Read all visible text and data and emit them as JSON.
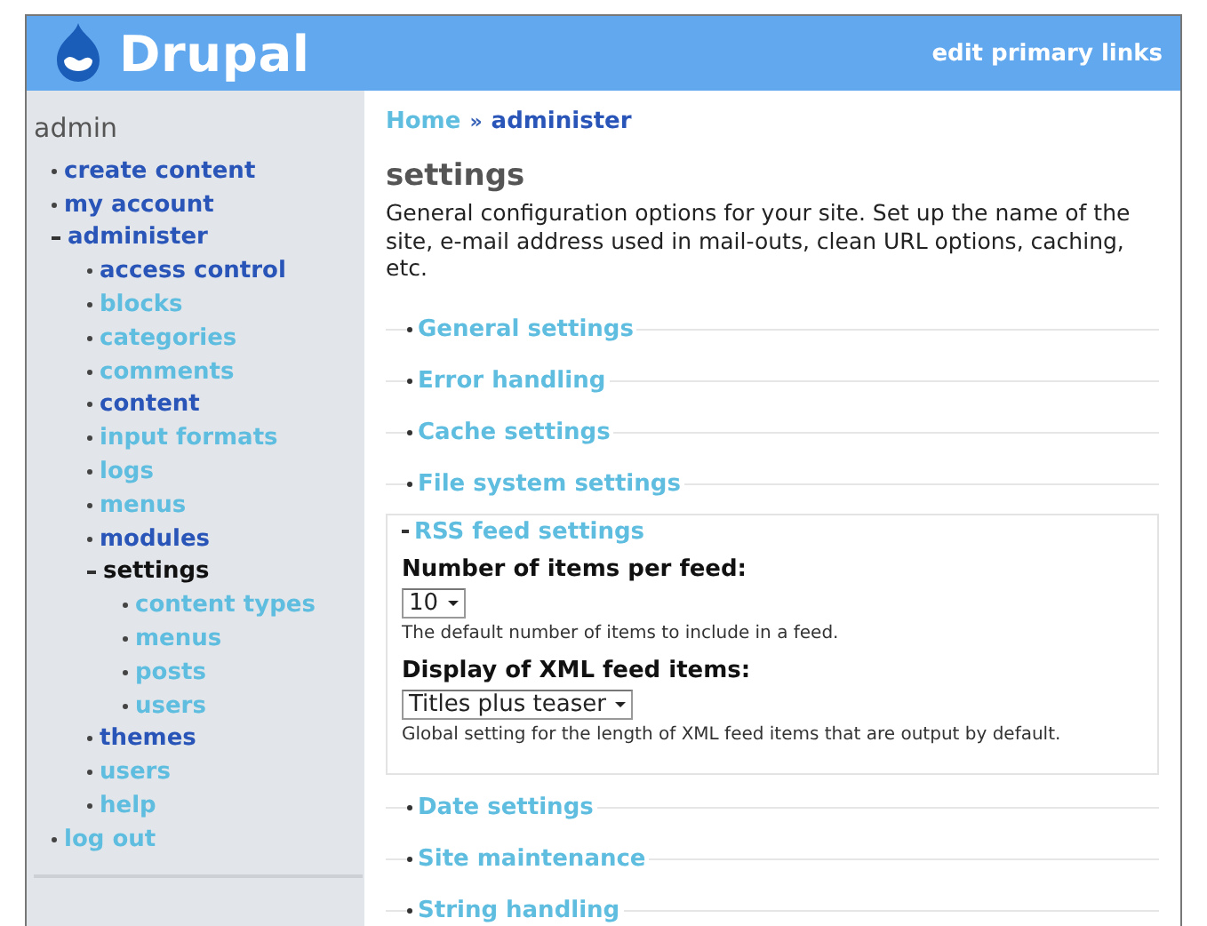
{
  "header": {
    "site_name": "Drupal",
    "primary_link": "edit primary links"
  },
  "sidebar": {
    "title": "admin",
    "items": [
      {
        "label": "create content",
        "visited": false,
        "active": false,
        "expanded": false
      },
      {
        "label": "my account",
        "visited": false,
        "active": false,
        "expanded": false
      },
      {
        "label": "administer",
        "visited": false,
        "active": false,
        "expanded": true,
        "children": [
          {
            "label": "access control",
            "visited": false,
            "active": false,
            "expanded": false
          },
          {
            "label": "blocks",
            "visited": true,
            "active": false,
            "expanded": false
          },
          {
            "label": "categories",
            "visited": true,
            "active": false,
            "expanded": false
          },
          {
            "label": "comments",
            "visited": true,
            "active": false,
            "expanded": false
          },
          {
            "label": "content",
            "visited": false,
            "active": false,
            "expanded": false
          },
          {
            "label": "input formats",
            "visited": true,
            "active": false,
            "expanded": false
          },
          {
            "label": "logs",
            "visited": true,
            "active": false,
            "expanded": false
          },
          {
            "label": "menus",
            "visited": true,
            "active": false,
            "expanded": false
          },
          {
            "label": "modules",
            "visited": false,
            "active": false,
            "expanded": false
          },
          {
            "label": "settings",
            "visited": false,
            "active": true,
            "expanded": true,
            "children": [
              {
                "label": "content types",
                "visited": true,
                "active": false,
                "expanded": false
              },
              {
                "label": "menus",
                "visited": true,
                "active": false,
                "expanded": false
              },
              {
                "label": "posts",
                "visited": true,
                "active": false,
                "expanded": false
              },
              {
                "label": "users",
                "visited": true,
                "active": false,
                "expanded": false
              }
            ]
          },
          {
            "label": "themes",
            "visited": false,
            "active": false,
            "expanded": false
          },
          {
            "label": "users",
            "visited": true,
            "active": false,
            "expanded": false
          },
          {
            "label": "help",
            "visited": true,
            "active": false,
            "expanded": false
          }
        ]
      },
      {
        "label": "log out",
        "visited": true,
        "active": false,
        "expanded": false
      }
    ]
  },
  "breadcrumb": [
    {
      "label": "Home",
      "visited": true
    },
    {
      "label": "administer",
      "visited": false
    }
  ],
  "breadcrumb_separator": "»",
  "page_title": "settings",
  "description": "General configuration options for your site. Set up the name of the site, e-mail address used in mail-outs, clean URL options, caching, etc.",
  "fieldsets": [
    {
      "legend": "General settings",
      "collapsed": true
    },
    {
      "legend": "Error handling",
      "collapsed": true
    },
    {
      "legend": "Cache settings",
      "collapsed": true
    },
    {
      "legend": "File system settings",
      "collapsed": true
    },
    {
      "legend": "RSS feed settings",
      "collapsed": false,
      "fields": [
        {
          "label": "Number of items per feed:",
          "value": "10",
          "help": "The default number of items to include in a feed."
        },
        {
          "label": "Display of XML feed items:",
          "value": "Titles plus teaser",
          "help": "Global setting for the length of XML feed items that are output by default."
        }
      ]
    },
    {
      "legend": "Date settings",
      "collapsed": true
    },
    {
      "legend": "Site maintenance",
      "collapsed": true
    },
    {
      "legend": "String handling",
      "collapsed": true
    }
  ]
}
